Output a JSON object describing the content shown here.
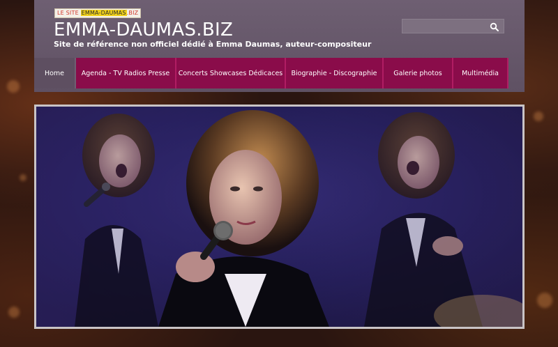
{
  "header": {
    "logo_badge": {
      "prefix": "LE SITE",
      "highlight": "EMMA-DAUMAS",
      "suffix": ".BIZ"
    },
    "title": "EMMA-DAUMAS.BIZ",
    "tagline": "Site de référence non officiel dédié à Emma Daumas, auteur-compositeur"
  },
  "search": {
    "value": "",
    "placeholder": "",
    "icon": "search-icon"
  },
  "nav": {
    "items": [
      {
        "label": "Home",
        "active": true
      },
      {
        "label": "Agenda - TV Radios Presse",
        "active": false
      },
      {
        "label": "Concerts Showcases Dédicaces",
        "active": false
      },
      {
        "label": "Biographie - Discographie",
        "active": false
      },
      {
        "label": "Galerie photos",
        "active": false
      },
      {
        "label": "Multimédia",
        "active": false
      }
    ]
  },
  "hero": {
    "description_icon": "hero-photo"
  },
  "colors": {
    "header_bg": "#6e5f72",
    "nav_bg": "#8a0c4a",
    "nav_active_bg": "#5e4f61",
    "hero_border": "#c9c4c6"
  }
}
